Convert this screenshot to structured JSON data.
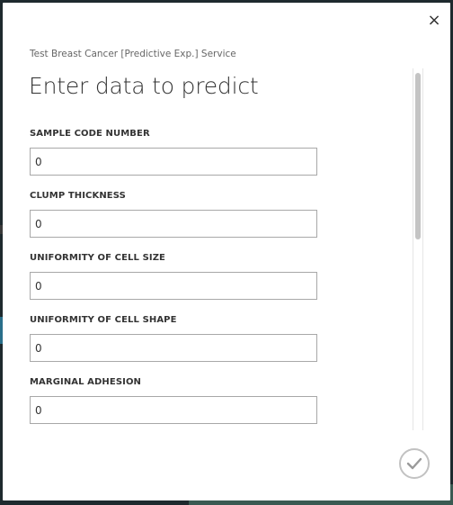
{
  "dialog": {
    "close_label": "×",
    "subtitle": "Test Breast Cancer [Predictive Exp.] Service",
    "title": "Enter data to predict"
  },
  "fields": [
    {
      "label": "SAMPLE CODE NUMBER",
      "value": "0"
    },
    {
      "label": "CLUMP THICKNESS",
      "value": "0"
    },
    {
      "label": "UNIFORMITY OF CELL SIZE",
      "value": "0"
    },
    {
      "label": "UNIFORMITY OF CELL SHAPE",
      "value": "0"
    },
    {
      "label": "MARGINAL ADHESION",
      "value": "0"
    }
  ],
  "actions": {
    "confirm_icon": "checkmark-icon"
  },
  "colors": {
    "accent": "#333333",
    "border": "#a8a8a8",
    "check_ring": "#c2c2c2"
  }
}
